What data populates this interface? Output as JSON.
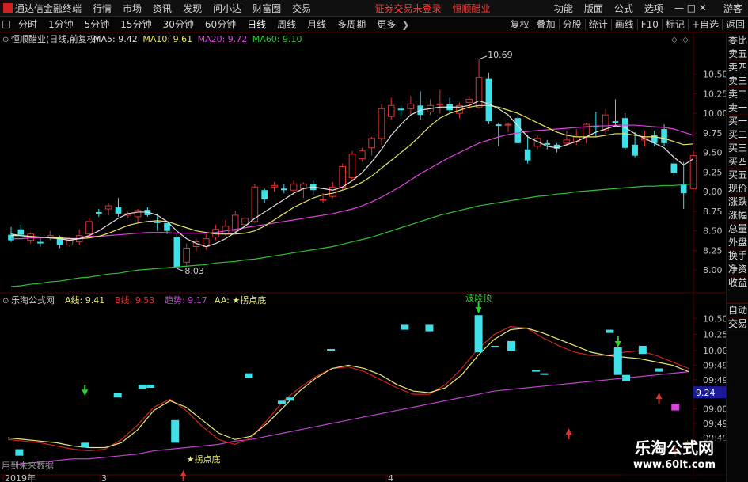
{
  "app": {
    "title": "通达信金融终端",
    "menu": [
      "行情",
      "市场",
      "资讯",
      "发现",
      "问小达",
      "财富圈",
      "交易"
    ],
    "notice": "证券交易未登录",
    "stock_tab": "恒顺醋业",
    "right_menu": [
      "功能",
      "版面",
      "公式",
      "选项"
    ],
    "guest": "游客"
  },
  "periods": [
    "分时",
    "1分钟",
    "5分钟",
    "15分钟",
    "30分钟",
    "60分钟",
    "日线",
    "周线",
    "月线",
    "多周期",
    "更多"
  ],
  "active_period": "日线",
  "toolbar": [
    "复权",
    "叠加",
    "分股",
    "统计",
    "画线",
    "F10",
    "标记",
    "+自选",
    "返回"
  ],
  "colors": {
    "up": "#e03030",
    "down": "#40e0e8",
    "ma5": "#e0e0e0",
    "ma10": "#e8e860",
    "ma20": "#e040e0",
    "ma60": "#30c030",
    "a_line": "#e8e878",
    "b_line": "#d02020",
    "trend": "#c040d0",
    "grid": "#5a0000"
  },
  "main_panel": {
    "stock": "恒顺醋业(日线,前复权)",
    "indicators": [
      {
        "label": "MA5:",
        "value": "9.42",
        "color": "#e0e0e0"
      },
      {
        "label": "MA10:",
        "value": "9.61",
        "color": "#e8e860"
      },
      {
        "label": "MA20:",
        "value": "9.72",
        "color": "#e040e0"
      },
      {
        "label": "MA60:",
        "value": "9.10",
        "color": "#30c030"
      }
    ],
    "y_ticks": [
      "10.50",
      "10.25",
      "10.00",
      "9.75",
      "9.50",
      "9.25",
      "9.00",
      "8.75",
      "8.50",
      "8.25",
      "8.00"
    ],
    "high_label": "10.69",
    "low_label": "8.03"
  },
  "sub_panel": {
    "name": "乐淘公式网",
    "indicators": [
      {
        "label": "A线:",
        "value": "9.41",
        "color": "#e8e878"
      },
      {
        "label": "B线:",
        "value": "9.53",
        "color": "#e03030"
      },
      {
        "label": "趋势:",
        "value": "9.17",
        "color": "#c040d0"
      },
      {
        "label": "AA:",
        "value": "★拐点底",
        "color": "#e8e878"
      }
    ],
    "y_ticks": [
      "10.50",
      "10.25",
      "10.00",
      "09:49",
      "09:49",
      "09:49",
      "09.00",
      "09:49",
      "09:49"
    ],
    "price_tag": "9.24",
    "top_label": "波段顶",
    "bottom_label": "★拐点底",
    "footnote": "用到未来数据"
  },
  "x_labels": [
    "2019年",
    "3",
    "4"
  ],
  "side_panel": [
    "委比",
    "卖五",
    "卖四",
    "卖三",
    "卖二",
    "卖一",
    "买一",
    "买二",
    "买三",
    "买四",
    "买五",
    "现价",
    "涨跌",
    "涨幅",
    "总量",
    "外盘",
    "换手",
    "净资",
    "收益",
    "",
    "自动",
    "交易"
  ],
  "watermark": {
    "title": "乐淘公式网",
    "url": "www.60lt.com"
  },
  "chart_data": {
    "type": "candlestick",
    "candles": [
      {
        "o": 8.45,
        "h": 8.55,
        "l": 8.36,
        "c": 8.38
      },
      {
        "o": 8.52,
        "h": 8.58,
        "l": 8.42,
        "c": 8.45
      },
      {
        "o": 8.38,
        "h": 8.48,
        "l": 8.34,
        "c": 8.46
      },
      {
        "o": 8.36,
        "h": 8.42,
        "l": 8.3,
        "c": 8.34
      },
      {
        "o": 8.42,
        "h": 8.5,
        "l": 8.38,
        "c": 8.44
      },
      {
        "o": 8.42,
        "h": 8.44,
        "l": 8.28,
        "c": 8.32
      },
      {
        "o": 8.32,
        "h": 8.42,
        "l": 8.3,
        "c": 8.4
      },
      {
        "o": 8.36,
        "h": 8.52,
        "l": 8.32,
        "c": 8.44
      },
      {
        "o": 8.46,
        "h": 8.66,
        "l": 8.4,
        "c": 8.62
      },
      {
        "o": 8.74,
        "h": 8.78,
        "l": 8.68,
        "c": 8.72
      },
      {
        "o": 8.78,
        "h": 8.85,
        "l": 8.7,
        "c": 8.82
      },
      {
        "o": 8.8,
        "h": 8.92,
        "l": 8.68,
        "c": 8.72
      },
      {
        "o": 8.7,
        "h": 8.74,
        "l": 8.66,
        "c": 8.72
      },
      {
        "o": 8.68,
        "h": 8.78,
        "l": 8.6,
        "c": 8.76
      },
      {
        "o": 8.77,
        "h": 8.8,
        "l": 8.68,
        "c": 8.7
      },
      {
        "o": 8.62,
        "h": 8.72,
        "l": 8.5,
        "c": 8.6
      },
      {
        "o": 8.6,
        "h": 8.6,
        "l": 8.46,
        "c": 8.5
      },
      {
        "o": 8.42,
        "h": 8.46,
        "l": 8.02,
        "c": 8.04
      },
      {
        "o": 8.1,
        "h": 8.34,
        "l": 8.06,
        "c": 8.28
      },
      {
        "o": 8.3,
        "h": 8.4,
        "l": 8.24,
        "c": 8.36
      },
      {
        "o": 8.3,
        "h": 8.46,
        "l": 8.26,
        "c": 8.4
      },
      {
        "o": 8.42,
        "h": 8.58,
        "l": 8.38,
        "c": 8.52
      },
      {
        "o": 8.46,
        "h": 8.64,
        "l": 8.44,
        "c": 8.56
      },
      {
        "o": 8.5,
        "h": 8.76,
        "l": 8.48,
        "c": 8.7
      },
      {
        "o": 8.58,
        "h": 8.82,
        "l": 8.54,
        "c": 8.66
      },
      {
        "o": 8.62,
        "h": 9.1,
        "l": 8.6,
        "c": 9.06
      },
      {
        "o": 9.02,
        "h": 9.04,
        "l": 8.86,
        "c": 8.9
      },
      {
        "o": 9.06,
        "h": 9.12,
        "l": 9.0,
        "c": 9.08
      },
      {
        "o": 9.04,
        "h": 9.1,
        "l": 8.98,
        "c": 9.02
      },
      {
        "o": 9.02,
        "h": 9.14,
        "l": 8.96,
        "c": 9.1
      },
      {
        "o": 9.04,
        "h": 9.12,
        "l": 8.92,
        "c": 9.1
      },
      {
        "o": 9.1,
        "h": 9.14,
        "l": 8.96,
        "c": 9.02
      },
      {
        "o": 8.9,
        "h": 8.98,
        "l": 8.86,
        "c": 8.9
      },
      {
        "o": 8.94,
        "h": 9.12,
        "l": 8.92,
        "c": 9.06
      },
      {
        "o": 9.06,
        "h": 9.36,
        "l": 9.02,
        "c": 9.32
      },
      {
        "o": 9.18,
        "h": 9.52,
        "l": 9.14,
        "c": 9.48
      },
      {
        "o": 9.42,
        "h": 9.56,
        "l": 9.38,
        "c": 9.52
      },
      {
        "o": 9.56,
        "h": 9.7,
        "l": 9.46,
        "c": 9.68
      },
      {
        "o": 9.68,
        "h": 10.12,
        "l": 9.6,
        "c": 10.06
      },
      {
        "o": 9.96,
        "h": 10.2,
        "l": 9.92,
        "c": 10.1
      },
      {
        "o": 10.06,
        "h": 10.1,
        "l": 9.96,
        "c": 10.04
      },
      {
        "o": 10.06,
        "h": 10.22,
        "l": 9.98,
        "c": 10.12
      },
      {
        "o": 10.1,
        "h": 10.28,
        "l": 9.92,
        "c": 9.98
      },
      {
        "o": 10.02,
        "h": 10.18,
        "l": 9.98,
        "c": 10.1
      },
      {
        "o": 10.12,
        "h": 10.3,
        "l": 10.0,
        "c": 10.12
      },
      {
        "o": 10.12,
        "h": 10.2,
        "l": 10.0,
        "c": 10.04
      },
      {
        "o": 10.0,
        "h": 10.14,
        "l": 9.94,
        "c": 10.1
      },
      {
        "o": 10.14,
        "h": 10.22,
        "l": 10.06,
        "c": 10.18
      },
      {
        "o": 10.08,
        "h": 10.69,
        "l": 10.06,
        "c": 10.46
      },
      {
        "o": 10.44,
        "h": 10.52,
        "l": 9.86,
        "c": 9.9
      },
      {
        "o": 9.86,
        "h": 9.88,
        "l": 9.58,
        "c": 9.84
      },
      {
        "o": 9.85,
        "h": 9.88,
        "l": 9.76,
        "c": 9.86
      },
      {
        "o": 9.94,
        "h": 9.96,
        "l": 9.62,
        "c": 9.62
      },
      {
        "o": 9.54,
        "h": 9.72,
        "l": 9.36,
        "c": 9.4
      },
      {
        "o": 9.58,
        "h": 9.72,
        "l": 9.54,
        "c": 9.68
      },
      {
        "o": 9.62,
        "h": 9.66,
        "l": 9.54,
        "c": 9.6
      },
      {
        "o": 9.6,
        "h": 9.62,
        "l": 9.5,
        "c": 9.55
      },
      {
        "o": 9.62,
        "h": 9.78,
        "l": 9.58,
        "c": 9.66
      },
      {
        "o": 9.64,
        "h": 9.8,
        "l": 9.6,
        "c": 9.7
      },
      {
        "o": 9.7,
        "h": 9.88,
        "l": 9.62,
        "c": 9.86
      },
      {
        "o": 9.84,
        "h": 10.02,
        "l": 9.7,
        "c": 9.82
      },
      {
        "o": 9.78,
        "h": 10.06,
        "l": 9.74,
        "c": 9.98
      },
      {
        "o": 9.9,
        "h": 10.18,
        "l": 9.84,
        "c": 9.88
      },
      {
        "o": 9.94,
        "h": 10.0,
        "l": 9.54,
        "c": 9.56
      },
      {
        "o": 9.6,
        "h": 9.76,
        "l": 9.44,
        "c": 9.46
      },
      {
        "o": 9.66,
        "h": 9.78,
        "l": 9.58,
        "c": 9.68
      },
      {
        "o": 9.72,
        "h": 9.78,
        "l": 9.58,
        "c": 9.62
      },
      {
        "o": 9.8,
        "h": 9.86,
        "l": 9.58,
        "c": 9.62
      },
      {
        "o": 9.36,
        "h": 9.5,
        "l": 9.2,
        "c": 9.24
      },
      {
        "o": 9.1,
        "h": 9.38,
        "l": 8.78,
        "c": 8.98
      },
      {
        "o": 9.04,
        "h": 9.52,
        "l": 9.04,
        "c": 9.46
      }
    ],
    "ma5": [
      8.46,
      8.44,
      8.42,
      8.42,
      8.41,
      8.4,
      8.38,
      8.4,
      8.44,
      8.5,
      8.58,
      8.66,
      8.72,
      8.74,
      8.74,
      8.7,
      8.62,
      8.5,
      8.4,
      8.34,
      8.3,
      8.34,
      8.4,
      8.48,
      8.56,
      8.66,
      8.74,
      8.82,
      8.9,
      8.98,
      9.04,
      9.06,
      9.04,
      9.02,
      9.06,
      9.14,
      9.24,
      9.38,
      9.54,
      9.72,
      9.86,
      9.98,
      10.04,
      10.06,
      10.08,
      10.08,
      10.08,
      10.1,
      10.16,
      10.12,
      10.06,
      9.98,
      9.84,
      9.7,
      9.64,
      9.58,
      9.56,
      9.6,
      9.64,
      9.7,
      9.76,
      9.8,
      9.84,
      9.82,
      9.74,
      9.68,
      9.62,
      9.56,
      9.44,
      9.34,
      9.42
    ],
    "ma10": [
      8.44,
      8.44,
      8.43,
      8.42,
      8.42,
      8.41,
      8.4,
      8.4,
      8.41,
      8.43,
      8.47,
      8.52,
      8.57,
      8.6,
      8.62,
      8.63,
      8.62,
      8.58,
      8.54,
      8.5,
      8.48,
      8.46,
      8.46,
      8.46,
      8.47,
      8.5,
      8.56,
      8.64,
      8.72,
      8.8,
      8.86,
      8.92,
      8.96,
      8.98,
      9.02,
      9.06,
      9.12,
      9.2,
      9.3,
      9.4,
      9.5,
      9.6,
      9.72,
      9.84,
      9.94,
      10.0,
      10.04,
      10.08,
      10.1,
      10.1,
      10.08,
      10.04,
      10.0,
      9.94,
      9.88,
      9.82,
      9.76,
      9.72,
      9.7,
      9.7,
      9.7,
      9.72,
      9.74,
      9.74,
      9.72,
      9.7,
      9.7,
      9.68,
      9.64,
      9.6,
      9.61
    ],
    "ma20": [
      8.4,
      8.4,
      8.41,
      8.41,
      8.42,
      8.42,
      8.42,
      8.42,
      8.43,
      8.43,
      8.44,
      8.45,
      8.46,
      8.47,
      8.48,
      8.48,
      8.48,
      8.47,
      8.47,
      8.47,
      8.47,
      8.48,
      8.5,
      8.52,
      8.54,
      8.56,
      8.58,
      8.6,
      8.62,
      8.64,
      8.66,
      8.68,
      8.7,
      8.72,
      8.75,
      8.78,
      8.82,
      8.87,
      8.93,
      9.0,
      9.07,
      9.15,
      9.23,
      9.3,
      9.37,
      9.44,
      9.5,
      9.56,
      9.62,
      9.66,
      9.7,
      9.73,
      9.75,
      9.77,
      9.78,
      9.79,
      9.8,
      9.81,
      9.82,
      9.83,
      9.84,
      9.84,
      9.85,
      9.85,
      9.85,
      9.84,
      9.83,
      9.82,
      9.8,
      9.76,
      9.72
    ],
    "ma60": [
      7.79,
      7.8,
      7.82,
      7.83,
      7.85,
      7.86,
      7.88,
      7.9,
      7.91,
      7.93,
      7.95,
      7.96,
      7.98,
      8.0,
      8.01,
      8.02,
      8.03,
      8.04,
      8.05,
      8.06,
      8.07,
      8.09,
      8.1,
      8.11,
      8.13,
      8.14,
      8.16,
      8.18,
      8.2,
      8.22,
      8.24,
      8.26,
      8.28,
      8.3,
      8.33,
      8.36,
      8.39,
      8.42,
      8.46,
      8.5,
      8.54,
      8.58,
      8.62,
      8.66,
      8.7,
      8.73,
      8.76,
      8.79,
      8.82,
      8.84,
      8.86,
      8.88,
      8.9,
      8.92,
      8.94,
      8.95,
      8.97,
      8.98,
      9.0,
      9.01,
      9.02,
      9.03,
      9.04,
      9.05,
      9.06,
      9.07,
      9.07,
      9.08,
      9.08,
      9.09,
      9.1
    ],
    "sub_boxes": [
      {
        "i": 1,
        "t": 0.08,
        "b": 0.12,
        "up": false
      },
      {
        "i": 9,
        "t": 0.13,
        "b": 0.16,
        "up": false
      },
      {
        "i": 13,
        "t": 0.44,
        "b": 0.47,
        "up": false
      },
      {
        "i": 16,
        "t": 0.49,
        "b": 0.52,
        "up": false
      },
      {
        "i": 17,
        "t": 0.5,
        "b": 0.52,
        "up": false
      },
      {
        "i": 20,
        "t": 0.16,
        "b": 0.3,
        "up": false
      },
      {
        "i": 29,
        "t": 0.56,
        "b": 0.59,
        "up": false
      },
      {
        "i": 33,
        "t": 0.4,
        "b": 0.42,
        "up": false
      },
      {
        "i": 34,
        "t": 0.42,
        "b": 0.44,
        "up": false
      },
      {
        "i": 39,
        "t": 0.73,
        "b": 0.74,
        "up": false
      },
      {
        "i": 48,
        "t": 0.86,
        "b": 0.89,
        "up": false
      },
      {
        "i": 51,
        "t": 0.85,
        "b": 0.89,
        "up": false
      },
      {
        "i": 57,
        "t": 0.72,
        "b": 0.95,
        "up": false
      },
      {
        "i": 59,
        "t": 0.75,
        "b": 0.76,
        "up": false
      },
      {
        "i": 61,
        "t": 0.73,
        "b": 0.79,
        "up": false
      },
      {
        "i": 64,
        "t": 0.6,
        "b": 0.61,
        "up": false
      },
      {
        "i": 65,
        "t": 0.58,
        "b": 0.59,
        "up": false
      },
      {
        "i": 73,
        "t": 0.84,
        "b": 0.86,
        "up": false
      },
      {
        "i": 74,
        "t": 0.58,
        "b": 0.75,
        "up": false
      },
      {
        "i": 75,
        "t": 0.54,
        "b": 0.58,
        "up": false
      },
      {
        "i": 77,
        "t": 0.71,
        "b": 0.76,
        "up": false
      },
      {
        "i": 79,
        "t": 0.6,
        "b": 0.62,
        "up": false
      },
      {
        "i": 81,
        "t": 0.36,
        "b": 0.4,
        "up": true
      }
    ],
    "a_line": [
      0.19,
      0.18,
      0.17,
      0.16,
      0.14,
      0.13,
      0.13,
      0.16,
      0.24,
      0.36,
      0.42,
      0.38,
      0.3,
      0.22,
      0.18,
      0.2,
      0.28,
      0.38,
      0.48,
      0.56,
      0.62,
      0.64,
      0.62,
      0.58,
      0.52,
      0.48,
      0.47,
      0.5,
      0.58,
      0.7,
      0.8,
      0.86,
      0.87,
      0.84,
      0.8,
      0.76,
      0.72,
      0.7,
      0.69,
      0.68,
      0.66,
      0.64,
      0.6
    ],
    "b_line": [
      0.18,
      0.17,
      0.16,
      0.14,
      0.12,
      0.11,
      0.12,
      0.18,
      0.27,
      0.38,
      0.43,
      0.36,
      0.26,
      0.18,
      0.15,
      0.19,
      0.3,
      0.42,
      0.5,
      0.57,
      0.62,
      0.63,
      0.6,
      0.55,
      0.5,
      0.46,
      0.46,
      0.52,
      0.62,
      0.74,
      0.83,
      0.88,
      0.87,
      0.81,
      0.76,
      0.72,
      0.7,
      0.7,
      0.72,
      0.73,
      0.7,
      0.66,
      0.62
    ],
    "trend": [
      0.02,
      0.03,
      0.04,
      0.05,
      0.06,
      0.06,
      0.07,
      0.08,
      0.09,
      0.11,
      0.12,
      0.13,
      0.14,
      0.15,
      0.17,
      0.18,
      0.2,
      0.22,
      0.24,
      0.26,
      0.28,
      0.3,
      0.32,
      0.34,
      0.36,
      0.38,
      0.4,
      0.42,
      0.44,
      0.46,
      0.48,
      0.49,
      0.5,
      0.51,
      0.52,
      0.53,
      0.54,
      0.55,
      0.56,
      0.57,
      0.58,
      0.59,
      0.6
    ],
    "y_range": [
      7.78,
      10.8
    ]
  }
}
